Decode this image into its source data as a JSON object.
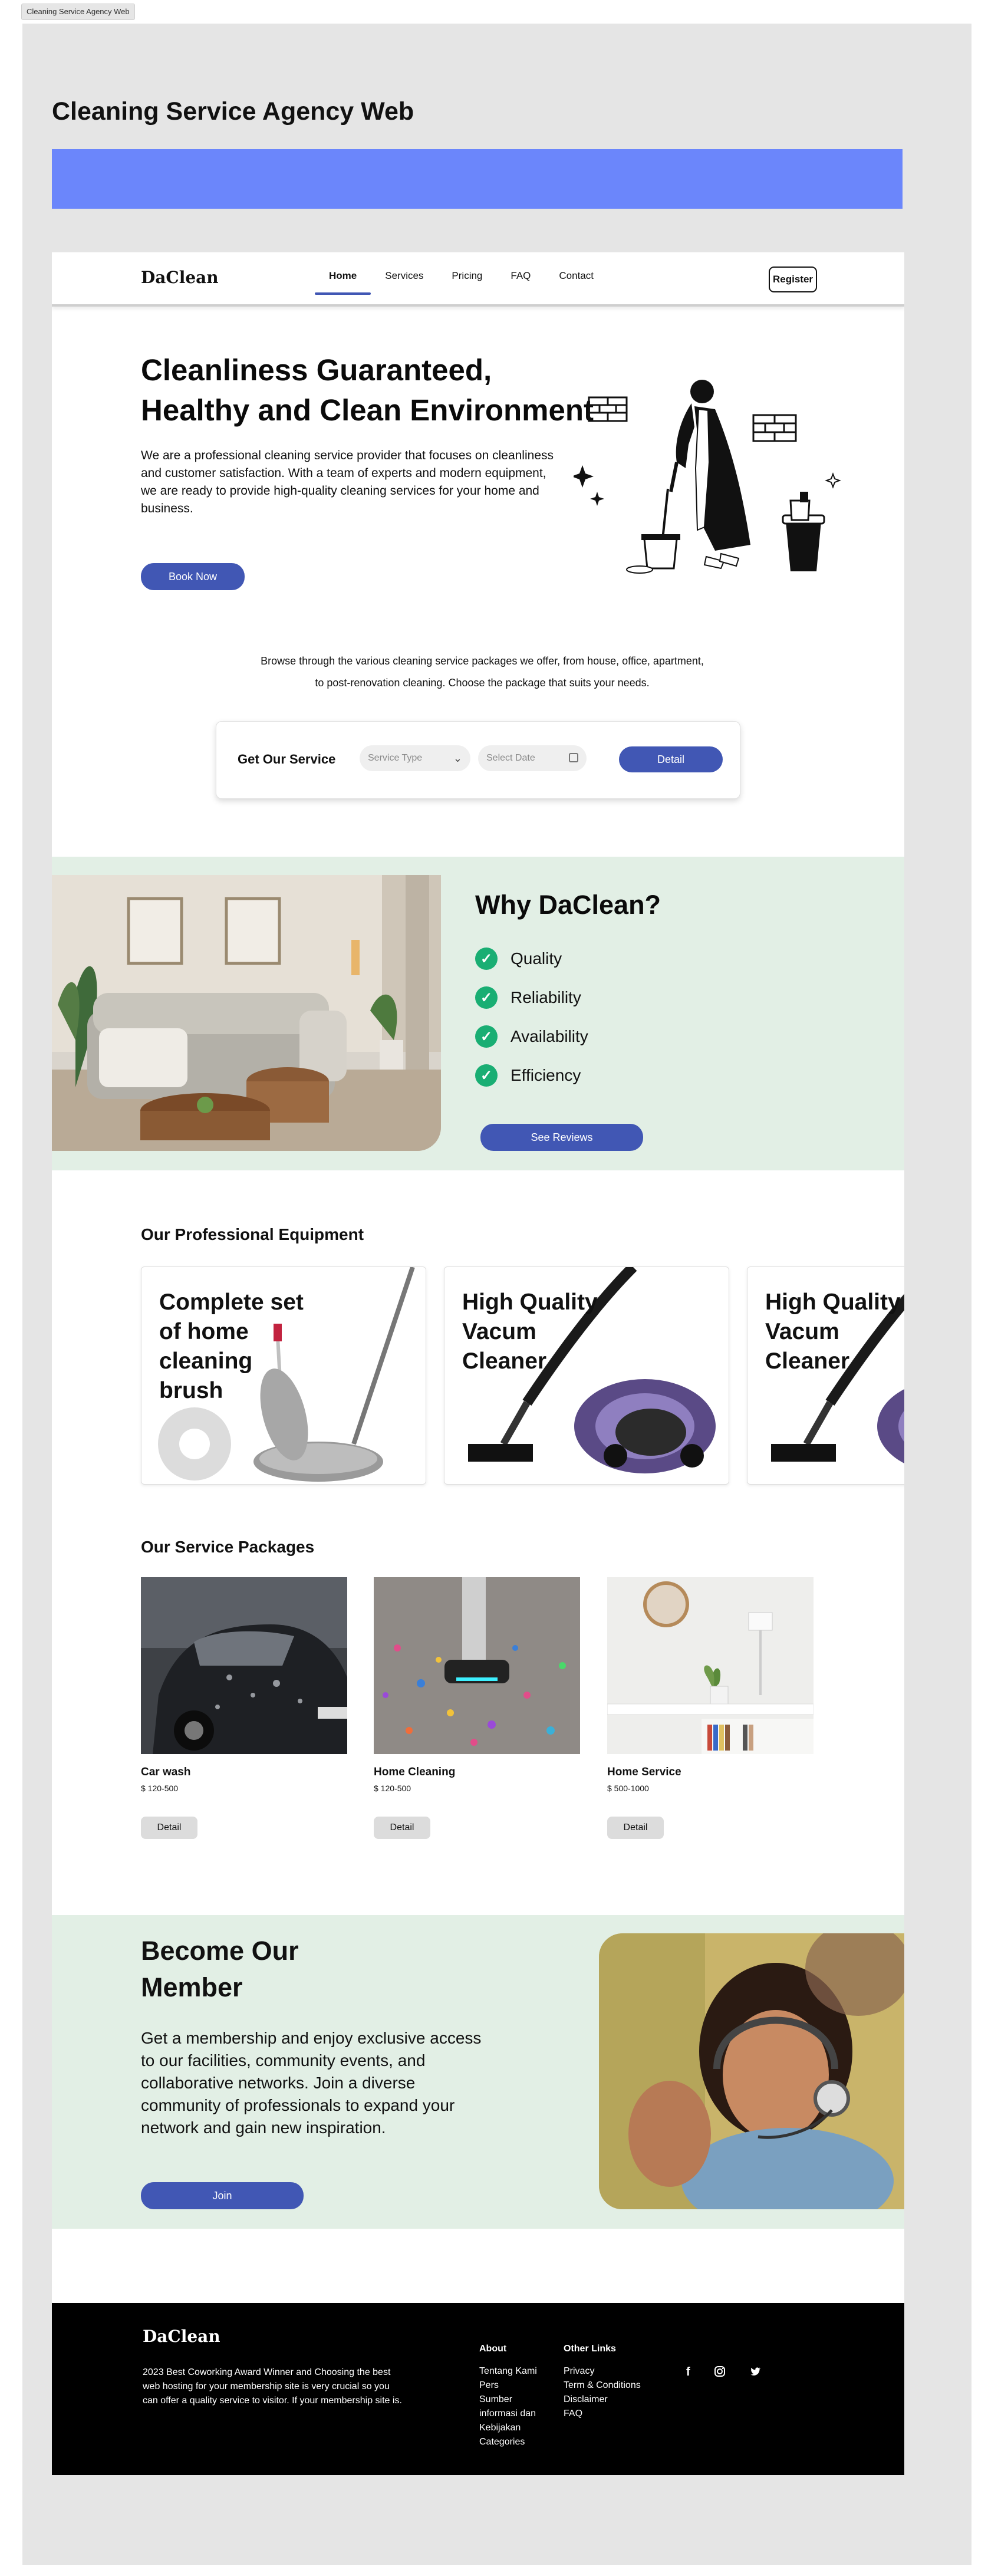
{
  "tab": {
    "title": "Cleaning Service Agency Web"
  },
  "frame": {
    "title": "Cleaning Service Agency Web"
  },
  "nav": {
    "logo": "DaClean",
    "links": [
      {
        "label": "Home",
        "active": true
      },
      {
        "label": "Services"
      },
      {
        "label": "Pricing"
      },
      {
        "label": "FAQ"
      },
      {
        "label": "Contact"
      }
    ],
    "register": "Register"
  },
  "hero": {
    "title": "Cleanliness Guaranteed, Healthy and Clean Environment",
    "text": "We are a professional cleaning service provider that focuses on cleanliness and customer satisfaction. With a team of experts and modern equipment, we are ready to provide high-quality cleaning services for your home and business.",
    "cta": "Book Now"
  },
  "intro": "Browse through the various cleaning service packages we offer, from house, office, apartment, to post-renovation cleaning. Choose the package that suits your needs.",
  "get_service": {
    "title": "Get Our Service",
    "service_type_placeholder": "Service Type",
    "date_placeholder": "Select Date",
    "button": "Detail"
  },
  "why": {
    "title": "Why DaClean?",
    "items": [
      "Quality",
      "Reliability",
      "Availability",
      "Efficiency"
    ],
    "cta": "See Reviews"
  },
  "equipment": {
    "title": "Our Professional Equipment",
    "cards": [
      {
        "label": "Complete set of home cleaning brush"
      },
      {
        "label": "High Quality Vacum Cleaner"
      },
      {
        "label": "High Quality Vacum Cleaner"
      }
    ]
  },
  "services": {
    "title": "Our Service Packages",
    "items": [
      {
        "name": "Car wash",
        "price": "$ 120-500",
        "button": "Detail"
      },
      {
        "name": "Home Cleaning",
        "price": "$ 120-500",
        "button": "Detail"
      },
      {
        "name": "Home Service",
        "price": "$ 500-1000",
        "button": "Detail"
      }
    ]
  },
  "member": {
    "title": "Become Our Member",
    "text": "Get a membership and enjoy exclusive access to our facilities, community events, and collaborative networks. Join a diverse community of professionals to expand your network and gain new inspiration.",
    "cta": "Join"
  },
  "footer": {
    "logo": "DaClean",
    "about_text": "2023 Best Coworking Award Winner and Choosing the best web hosting for your membership site is very crucial so you can offer a quality service to visitor. If your membership site is.",
    "col1": {
      "title": "About",
      "links": [
        "Tentang Kami",
        "Pers",
        "Sumber informasi dan Kebijakan",
        "Categories"
      ]
    },
    "col2": {
      "title": "Other Links",
      "links": [
        "Privacy",
        "Term & Conditions",
        "Disclaimer",
        "FAQ"
      ]
    },
    "socials": [
      "facebook-icon",
      "instagram-icon",
      "twitter-icon"
    ]
  },
  "colors": {
    "primary": "#4157b4",
    "banner": "#6b86fb",
    "section_bg": "#e2efe5",
    "check": "#19ae73",
    "footer": "#000000"
  }
}
